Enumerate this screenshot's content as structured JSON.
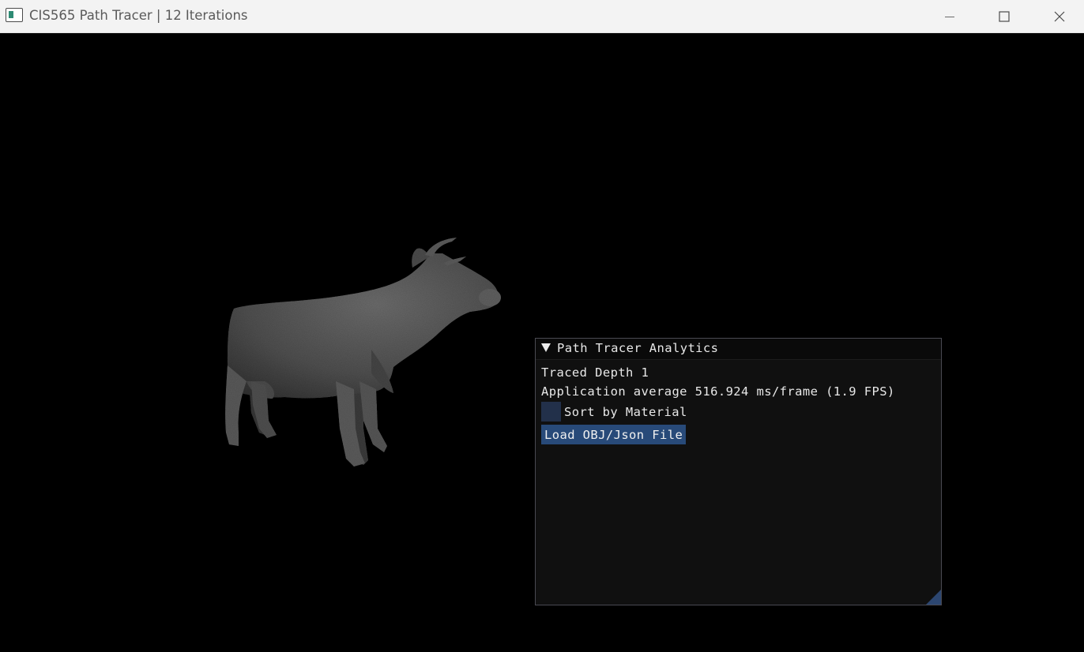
{
  "window": {
    "title": "CIS565 Path Tracer | 12 Iterations",
    "app_icon": "app-window-icon",
    "controls": {
      "minimize_icon": "minimize-icon",
      "maximize_icon": "maximize-icon",
      "close_icon": "close-icon"
    }
  },
  "viewport": {
    "background": "#000000",
    "render_subject": "cow-render"
  },
  "analytics_panel": {
    "title": "Path Tracer Analytics",
    "collapse_icon": "triangle-down-icon",
    "traced_depth": "Traced Depth 1",
    "average_text": "Application average 516.924 ms/frame (1.9 FPS)",
    "sort_checkbox": {
      "label": "Sort by Material",
      "checked": false
    },
    "load_button": "Load OBJ/Json File",
    "colors": {
      "panel_bg": "#101010",
      "button_bg": "#284a79",
      "checkbox_bg": "#22304a",
      "grip": "#2c4670"
    }
  }
}
